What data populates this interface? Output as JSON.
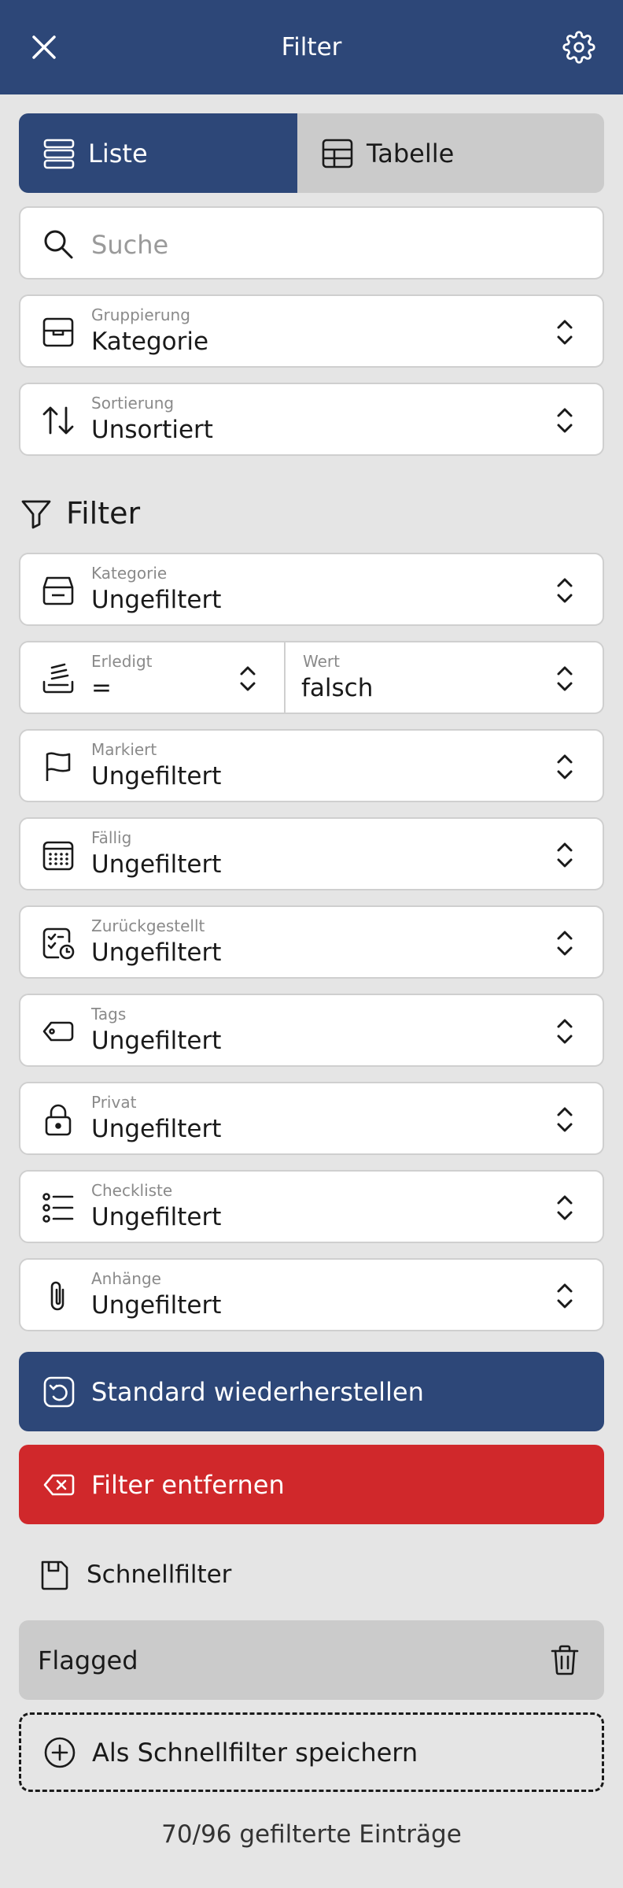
{
  "header": {
    "title": "Filter",
    "close_icon": "close-icon",
    "settings_icon": "gear-icon",
    "bg_color": "#2d4778"
  },
  "view_toggle": {
    "list_label": "Liste",
    "table_label": "Tabelle",
    "selected": "Liste"
  },
  "search": {
    "placeholder": "Suche"
  },
  "grouping": {
    "label": "Gruppierung",
    "value": "Kategorie"
  },
  "sorting": {
    "label": "Sortierung",
    "value": "Unsortiert"
  },
  "filter_section": {
    "title": "Filter"
  },
  "filters": {
    "category": {
      "label": "Kategorie",
      "value": "Ungefiltert"
    },
    "done": {
      "label": "Erledigt",
      "operator": "=",
      "value_label": "Wert",
      "value": "falsch"
    },
    "marked": {
      "label": "Markiert",
      "value": "Ungefiltert"
    },
    "due": {
      "label": "Fällig",
      "value": "Ungefiltert"
    },
    "deferred": {
      "label": "Zurückgestellt",
      "value": "Ungefiltert"
    },
    "tags": {
      "label": "Tags",
      "value": "Ungefiltert"
    },
    "private": {
      "label": "Privat",
      "value": "Ungefiltert"
    },
    "checklist": {
      "label": "Checkliste",
      "value": "Ungefiltert"
    },
    "attachments": {
      "label": "Anhänge",
      "value": "Ungefiltert"
    }
  },
  "actions": {
    "restore_label": "Standard wiederherstellen",
    "remove_label": "Filter entfernen",
    "restore_color": "#2d4778",
    "remove_color": "#d0282b"
  },
  "quick_filters": {
    "title": "Schnellfilter",
    "items": [
      {
        "label": "Flagged"
      }
    ],
    "save_label": "Als Schnellfilter speichern"
  },
  "footer": {
    "count_text": "70/96 gefilterte Einträge"
  }
}
